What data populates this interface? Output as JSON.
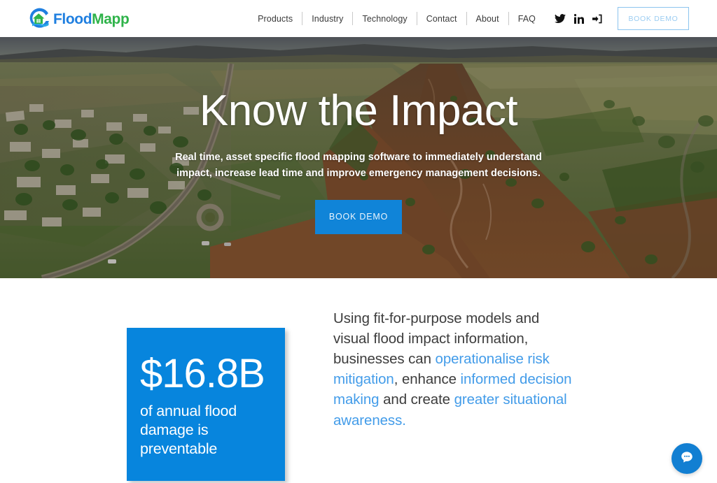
{
  "brand": {
    "name_part1": "Flood",
    "name_part2": "Mapp",
    "logo_icon": "house-in-water-circle-icon",
    "blue": "#1f7fe0",
    "green": "#2fb34a"
  },
  "nav": {
    "links": [
      {
        "label": "Products"
      },
      {
        "label": "Industry"
      },
      {
        "label": "Technology"
      },
      {
        "label": "Contact"
      },
      {
        "label": "About"
      },
      {
        "label": "FAQ"
      }
    ],
    "icons": [
      {
        "name": "twitter-icon"
      },
      {
        "name": "linkedin-icon"
      },
      {
        "name": "login-icon"
      }
    ],
    "cta_label": "BOOK DEMO",
    "cta_border_color": "#8cc4ef",
    "cta_text_color": "#9ccdf2"
  },
  "hero": {
    "title": "Know the Impact",
    "subtitle": "Real time, asset specific flood mapping software to immediately understand impact, increase lead time and improve emergency management decisions.",
    "cta_label": "BOOK DEMO",
    "cta_color": "#1084d8",
    "background_image": "aerial-photo-of-flooded-river-and-town"
  },
  "stats": {
    "value": "$16.8B",
    "label": "of annual flood damage is preventable",
    "box_color": "#0785dd",
    "copy": [
      {
        "text": "Using fit-for-purpose models and visual flood impact information, businesses can ",
        "highlight": false
      },
      {
        "text": "operationalise risk mitigation",
        "highlight": true
      },
      {
        "text": ", enhance ",
        "highlight": false
      },
      {
        "text": "informed decision making",
        "highlight": true
      },
      {
        "text": " and create ",
        "highlight": false
      },
      {
        "text": "greater situational awareness.",
        "highlight": true
      }
    ],
    "highlight_color": "#439ce9"
  },
  "chat": {
    "icon": "chat-bubble-icon",
    "color": "#127fd2"
  }
}
